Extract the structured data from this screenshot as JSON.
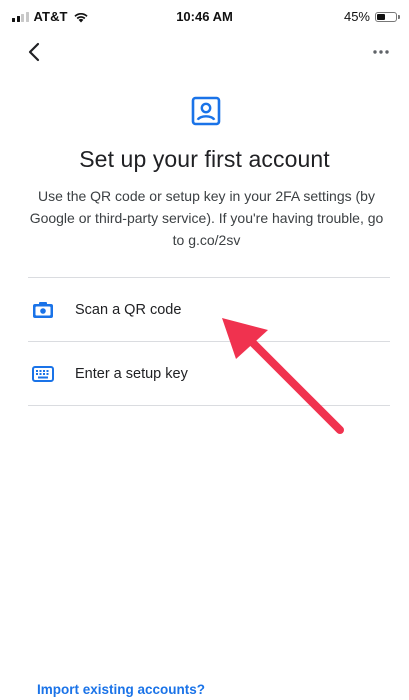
{
  "status_bar": {
    "carrier": "AT&T",
    "time": "10:46 AM",
    "battery_percent": "45%",
    "battery_level": 0.45,
    "icons": [
      "signal-icon",
      "wifi-icon",
      "battery-icon"
    ]
  },
  "app_bar": {
    "back_icon": "chevron-left-icon",
    "more_icon": "more-horizontal-icon"
  },
  "header": {
    "icon": "account-box-icon",
    "title": "Set up your first account",
    "description": "Use the QR code or setup key in your 2FA settings (by Google or third-party service). If you're having trouble, go to g.co/2sv"
  },
  "options": [
    {
      "icon": "camera-icon",
      "label": "Scan a QR code"
    },
    {
      "icon": "keyboard-icon",
      "label": "Enter a setup key"
    }
  ],
  "footer": {
    "import_link": "Import existing accounts?"
  },
  "colors": {
    "accent": "#1a73e8",
    "annotation_arrow": "#f0324f",
    "divider": "#dadce0",
    "text": "#202124"
  }
}
